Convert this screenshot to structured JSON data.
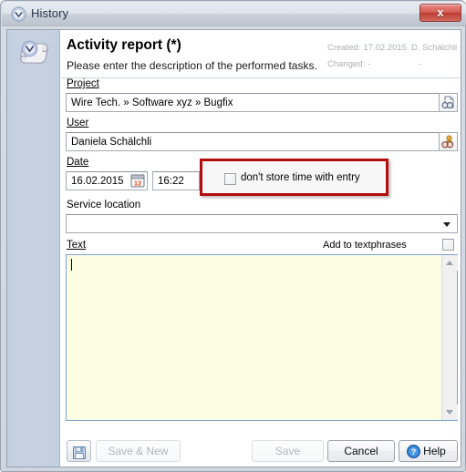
{
  "window": {
    "title": "History",
    "title_icon": "clock-icon",
    "close_label": "x"
  },
  "sidebar": {
    "icon": "history-scroll-clock-icon"
  },
  "header": {
    "title": "Activity report (*)",
    "subtitle": "Please enter the description of the performed tasks.",
    "created_label": "Created:",
    "created_date": "17.02.2015",
    "created_user": "D. Schälchli",
    "changed_label": "Changed:",
    "changed_date": "-",
    "changed_user": "-"
  },
  "form": {
    "project": {
      "label": "Project",
      "value": "Wire Tech. » Software xyz » Bugfix",
      "browse_icon": "document-lookup-icon"
    },
    "user": {
      "label": "User",
      "value": "Daniela Schälchli",
      "browse_icon": "user-lookup-icon"
    },
    "date": {
      "label": "Date",
      "value": "16.02.2015",
      "calendar_icon": "calendar-icon",
      "calendar_day": "12"
    },
    "time": {
      "value": "16:22"
    },
    "dont_store_time": {
      "label": "don't store time with entry",
      "checked": false,
      "highlight_color": "#b30d0d"
    },
    "service_location": {
      "label": "Service location",
      "value": "",
      "arrow_icon": "chevron-down-icon"
    },
    "text": {
      "label": "Text",
      "value": "",
      "add_to_textphrases_label": "Add to textphrases",
      "add_to_textphrases_checked": false
    }
  },
  "footer": {
    "save_icon": "floppy-disk-icon",
    "save_and_new": "Save & New",
    "save": "Save",
    "cancel": "Cancel",
    "help": "Help",
    "help_icon": "question-mark-icon"
  }
}
